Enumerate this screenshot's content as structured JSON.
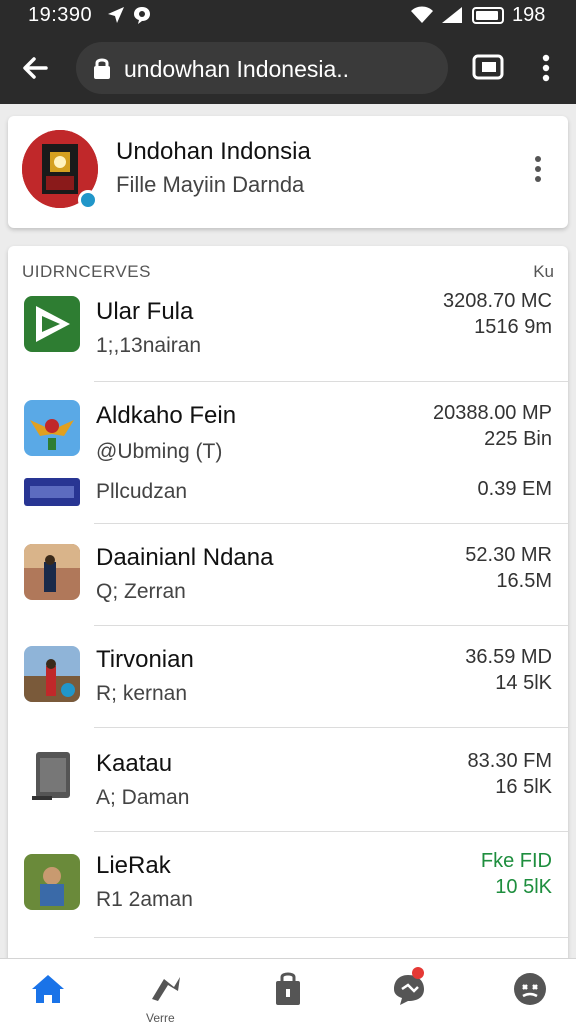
{
  "status_bar": {
    "time": "19:390",
    "battery_text": "198"
  },
  "browser": {
    "url": "undowhan Indonesia.."
  },
  "profile": {
    "name": "Undohan Indonsia",
    "subtitle": "Fille Mayiin Darnda"
  },
  "list": {
    "header_left": "UIDRNCERVES",
    "header_right": "Ku",
    "items": [
      {
        "title": "Ular Fula",
        "sub": "1;,13nairan",
        "size1": "3208.70 MC",
        "size2": "1516 9m",
        "icon": "play-icon"
      },
      {
        "title": "Aldkaho Fein",
        "sub": "@Ubming (T)",
        "sub2": "Pllcudzan",
        "size1": "20388.00 MP",
        "size2": "225 Bin",
        "size3": "0.39 EM",
        "icon": "garuda-icon"
      },
      {
        "title": "Daainianl Ndana",
        "sub": "Q; Zerran",
        "size1": "52.30 MR",
        "size2": "16.5M",
        "icon": "photo-icon"
      },
      {
        "title": "Tirvonian",
        "sub": "R; kernan",
        "size1": "36.59 MD",
        "size2": "14 5lK",
        "icon": "photo-icon"
      },
      {
        "title": "Kaatau",
        "sub": "A; Daman",
        "size1": "83.30 FM",
        "size2": "16 5lK",
        "icon": "device-icon"
      },
      {
        "title": "LieRak",
        "sub": "R1 2aman",
        "size1": "Fke FID",
        "size2": "10 5lK",
        "icon": "photo-icon",
        "highlight_color": "#1e8e3e"
      }
    ]
  },
  "bottom_nav": {
    "active_label": "Verre",
    "accent": "#1a73e8"
  }
}
